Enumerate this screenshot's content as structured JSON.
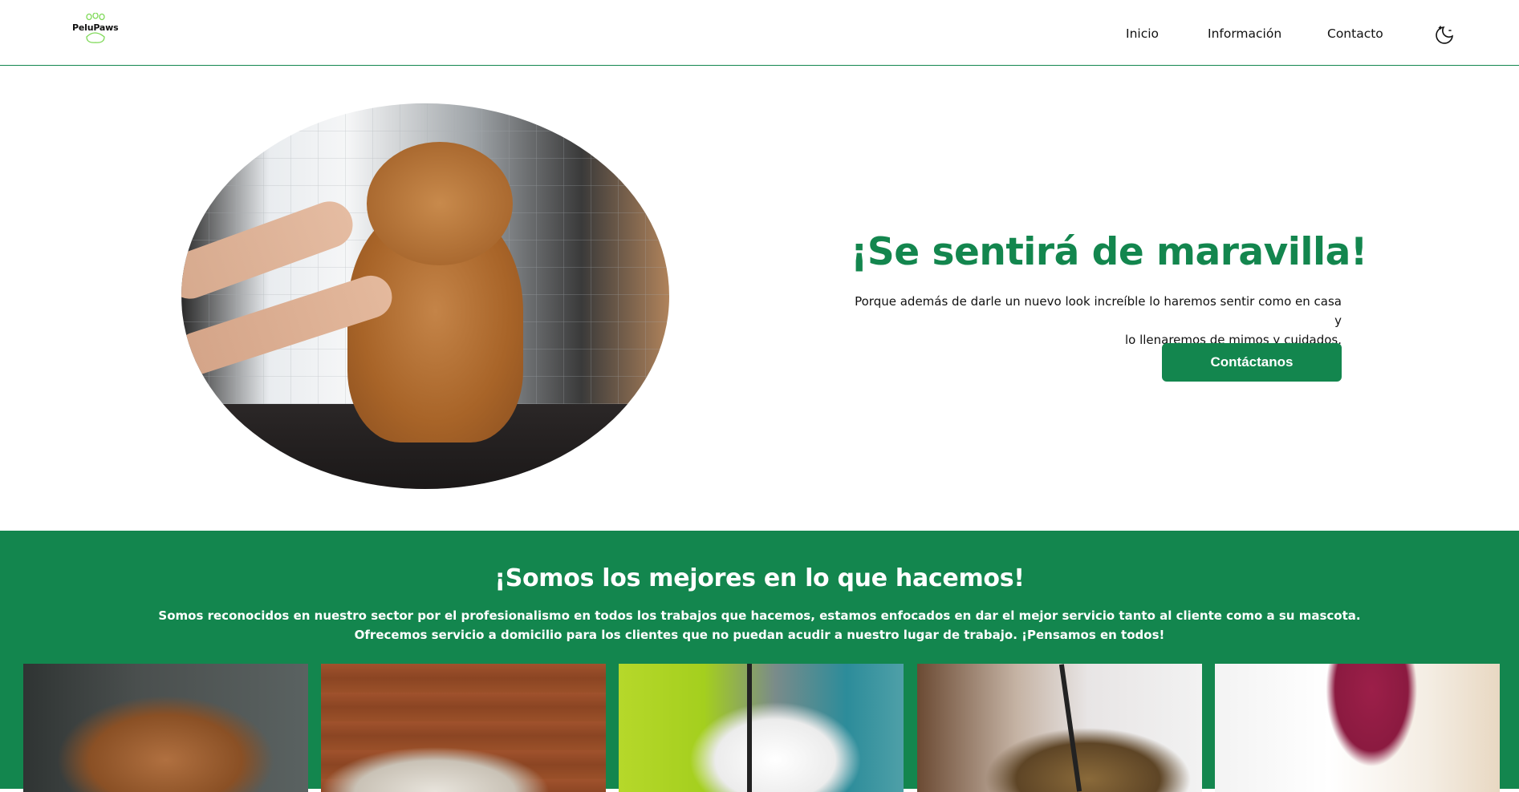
{
  "header": {
    "logo_text": "PeluPaws",
    "nav": [
      {
        "label": "Inicio"
      },
      {
        "label": "Información"
      },
      {
        "label": "Contacto"
      }
    ],
    "theme_toggle_icon": "moon-icon"
  },
  "hero": {
    "image_alt": "dog-grooming-photo",
    "title": "¡Se sentirá de maravilla!",
    "text_line1": "Porque además de darle un nuevo look increíble lo haremos sentir como en casa y",
    "text_line2": "lo llenaremos de mimos y cuidados.",
    "cta_label": "Contáctanos"
  },
  "about": {
    "title": "¡Somos los mejores en lo que hacemos!",
    "text_line1": "Somos reconocidos en nuestro sector por el profesionalismo en todos los trabajos que hacemos, estamos enfocados en dar el mejor servicio tanto al cliente como a su mascota.",
    "text_line2": "Ofrecemos servicio a domicilio para los clientes que no puedan acudir a nuestro lugar de trabajo. ¡Pensamos en todos!"
  },
  "colors": {
    "brand_green": "#13864e",
    "text": "#111111",
    "background": "#ffffff"
  }
}
